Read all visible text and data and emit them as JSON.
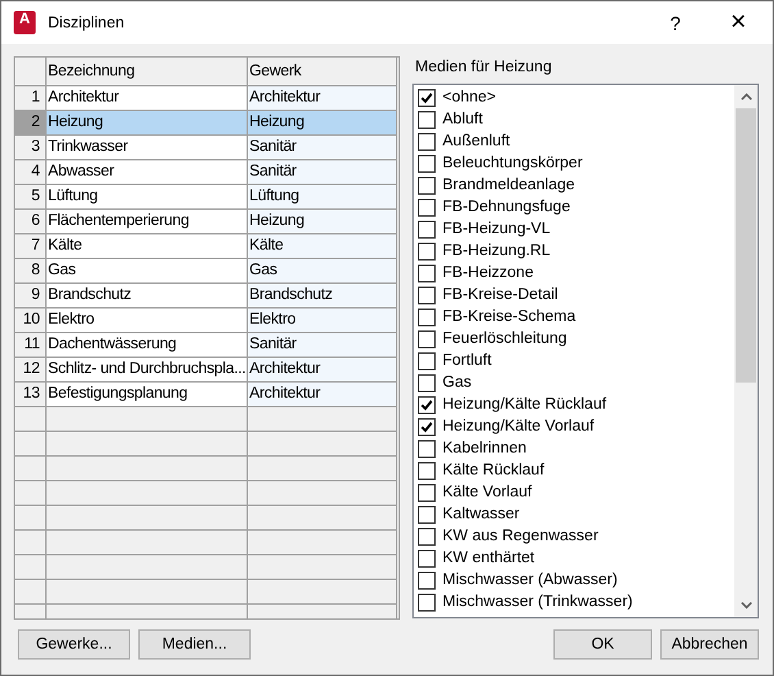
{
  "window": {
    "title": "Disziplinen",
    "icon_letter": "A",
    "help": "?",
    "close": "×"
  },
  "grid": {
    "columns": [
      "Bezeichnung",
      "Gewerk"
    ],
    "rows": [
      {
        "number": "1",
        "name": "Architektur",
        "trade": "Architektur",
        "selected": false
      },
      {
        "number": "2",
        "name": "Heizung",
        "trade": "Heizung",
        "selected": true
      },
      {
        "number": "3",
        "name": "Trinkwasser",
        "trade": "Sanitär",
        "selected": false
      },
      {
        "number": "4",
        "name": "Abwasser",
        "trade": "Sanitär",
        "selected": false
      },
      {
        "number": "5",
        "name": "Lüftung",
        "trade": "Lüftung",
        "selected": false
      },
      {
        "number": "6",
        "name": "Flächentemperierung",
        "trade": "Heizung",
        "selected": false
      },
      {
        "number": "7",
        "name": "Kälte",
        "trade": "Kälte",
        "selected": false
      },
      {
        "number": "8",
        "name": "Gas",
        "trade": "Gas",
        "selected": false
      },
      {
        "number": "9",
        "name": "Brandschutz",
        "trade": "Brandschutz",
        "selected": false
      },
      {
        "number": "10",
        "name": "Elektro",
        "trade": "Elektro",
        "selected": false
      },
      {
        "number": "11",
        "name": "Dachentwässerung",
        "trade": "Sanitär",
        "selected": false
      },
      {
        "number": "12",
        "name": "Schlitz- und Durchbruchspla...",
        "trade": "Architektur",
        "selected": false
      },
      {
        "number": "13",
        "name": "Befestigungsplanung",
        "trade": "Architektur",
        "selected": false
      }
    ]
  },
  "media": {
    "label": "Medien für Heizung",
    "items": [
      {
        "label": "<ohne>",
        "checked": true
      },
      {
        "label": "Abluft",
        "checked": false
      },
      {
        "label": "Außenluft",
        "checked": false
      },
      {
        "label": "Beleuchtungskörper",
        "checked": false
      },
      {
        "label": "Brandmeldeanlage",
        "checked": false
      },
      {
        "label": "FB-Dehnungsfuge",
        "checked": false
      },
      {
        "label": "FB-Heizung-VL",
        "checked": false
      },
      {
        "label": "FB-Heizung.RL",
        "checked": false
      },
      {
        "label": "FB-Heizzone",
        "checked": false
      },
      {
        "label": "FB-Kreise-Detail",
        "checked": false
      },
      {
        "label": "FB-Kreise-Schema",
        "checked": false
      },
      {
        "label": "Feuerlöschleitung",
        "checked": false
      },
      {
        "label": "Fortluft",
        "checked": false
      },
      {
        "label": "Gas",
        "checked": false
      },
      {
        "label": "Heizung/Kälte Rücklauf",
        "checked": true
      },
      {
        "label": "Heizung/Kälte Vorlauf",
        "checked": true
      },
      {
        "label": "Kabelrinnen",
        "checked": false
      },
      {
        "label": "Kälte Rücklauf",
        "checked": false
      },
      {
        "label": "Kälte Vorlauf",
        "checked": false
      },
      {
        "label": "Kaltwasser",
        "checked": false
      },
      {
        "label": "KW aus Regenwasser",
        "checked": false
      },
      {
        "label": "KW enthärtet",
        "checked": false
      },
      {
        "label": "Mischwasser (Abwasser)",
        "checked": false
      },
      {
        "label": "Mischwasser (Trinkwasser)",
        "checked": false
      }
    ]
  },
  "buttons_left": [
    "Gewerke...",
    "Medien..."
  ],
  "buttons_right": [
    "OK",
    "Abbrechen"
  ]
}
